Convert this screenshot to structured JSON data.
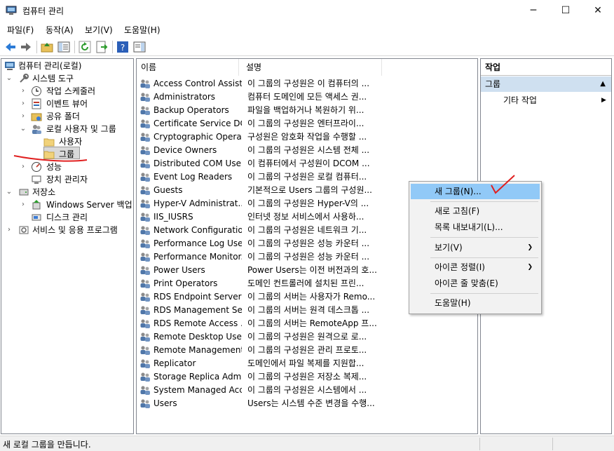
{
  "window": {
    "title": "컴퓨터 관리"
  },
  "menu": [
    "파일(F)",
    "동작(A)",
    "보기(V)",
    "도움말(H)"
  ],
  "tree": {
    "root": "컴퓨터 관리(로컬)",
    "system_tools": "시스템 도구",
    "task_scheduler": "작업 스케줄러",
    "event_viewer": "이벤트 뷰어",
    "shared_folders": "공유 폴더",
    "local_users_groups": "로컬 사용자 및 그룹",
    "users": "사용자",
    "groups": "그룹",
    "performance": "성능",
    "device_manager": "장치 관리자",
    "storage": "저장소",
    "windows_server_backup": "Windows Server 백업",
    "disk_management": "디스크 관리",
    "services_apps": "서비스 및 응용 프로그램"
  },
  "list": {
    "columns": [
      "이름",
      "설명"
    ],
    "rows": [
      {
        "name": "Access Control Assist...",
        "desc": "이 그룹의 구성원은 이 컴퓨터의 ..."
      },
      {
        "name": "Administrators",
        "desc": "컴퓨터 도메인에 모든 액세스 권..."
      },
      {
        "name": "Backup Operators",
        "desc": "파일을 백업하거나 복원하기 위..."
      },
      {
        "name": "Certificate Service DC...",
        "desc": "이 그룹의 구성원은 엔터프라이..."
      },
      {
        "name": "Cryptographic Operat...",
        "desc": "구성원은 암호화 작업을 수행할 ..."
      },
      {
        "name": "Device Owners",
        "desc": "이 그룹의 구성원은 시스템 전체 ..."
      },
      {
        "name": "Distributed COM Users",
        "desc": "이 컴퓨터에서 구성원이 DCOM ..."
      },
      {
        "name": "Event Log Readers",
        "desc": "이 그룹의 구성원은 로컬 컴퓨터..."
      },
      {
        "name": "Guests",
        "desc": "기본적으로 Users 그룹의 구성원..."
      },
      {
        "name": "Hyper-V Administrat...",
        "desc": "이 그룹의 구성원은 Hyper-V의 ..."
      },
      {
        "name": "IIS_IUSRS",
        "desc": "인터넷 정보 서비스에서 사용하..."
      },
      {
        "name": "Network Configuratio...",
        "desc": "이 그룹의 구성원은 네트워크 기..."
      },
      {
        "name": "Performance Log Users",
        "desc": "이 그룹의 구성원은 성능 카운터 ..."
      },
      {
        "name": "Performance Monitor...",
        "desc": "이 그룹의 구성원은 성능 카운터 ..."
      },
      {
        "name": "Power Users",
        "desc": "Power Users는 이전 버전과의 호..."
      },
      {
        "name": "Print Operators",
        "desc": "도메인 컨트롤러에 설치된 프린..."
      },
      {
        "name": "RDS Endpoint Servers",
        "desc": "이 그룹의 서버는 사용자가 Remo..."
      },
      {
        "name": "RDS Management Se...",
        "desc": "이 그룹의 서버는 원격 데스크톱 ..."
      },
      {
        "name": "RDS Remote Access ...",
        "desc": "이 그룹의 서버는 RemoteApp 프..."
      },
      {
        "name": "Remote Desktop Users",
        "desc": "이 그룹의 구성원은 원격으로 로..."
      },
      {
        "name": "Remote Management...",
        "desc": "이 그룹의 구성원은 관리 프로토..."
      },
      {
        "name": "Replicator",
        "desc": "도메인에서 파일 복제를 지원합..."
      },
      {
        "name": "Storage Replica Admi...",
        "desc": "이 그룹의 구성원은 저장소 복제..."
      },
      {
        "name": "System Managed Acc...",
        "desc": "이 그룹의 구성원은 시스템에서 ..."
      },
      {
        "name": "Users",
        "desc": "Users는 시스템 수준 변경을 수행..."
      }
    ]
  },
  "actions": {
    "header": "작업",
    "section": "그룹",
    "more": "기타 작업"
  },
  "context_menu": {
    "new_group": "새 그룹(N)...",
    "refresh": "새로 고침(F)",
    "export_list": "목록 내보내기(L)...",
    "view": "보기(V)",
    "arrange_icons": "아이콘 정렬(I)",
    "line_up_icons": "아이콘 줄 맞춤(E)",
    "help": "도움말(H)"
  },
  "status": {
    "text": "새 로컬 그룹을 만듭니다."
  },
  "colors": {
    "selection": "#91c9f7",
    "section_bg": "#cfe0f0",
    "annotation": "#e02020"
  }
}
